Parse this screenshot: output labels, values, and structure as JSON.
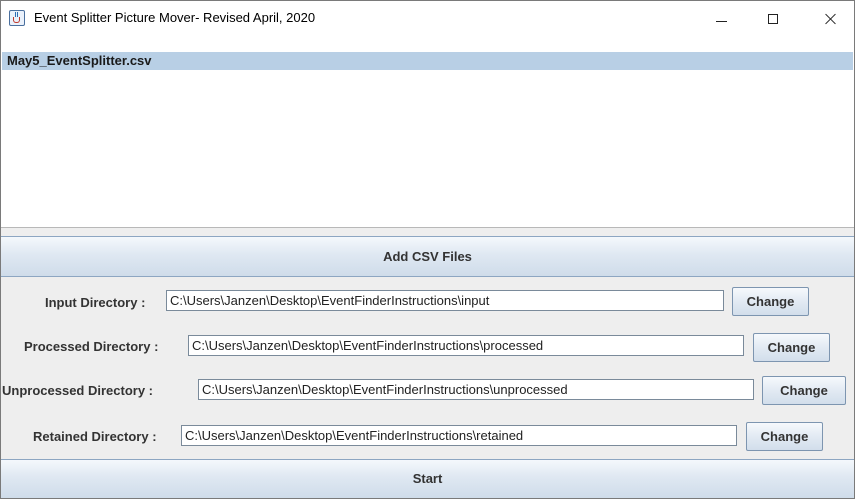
{
  "window": {
    "title": "Event Splitter Picture Mover- Revised April, 2020",
    "icon": "java-cup-icon"
  },
  "file_list": {
    "items": [
      {
        "label": "May5_EventSplitter.csv",
        "selected": true
      }
    ]
  },
  "add_csv_button": {
    "label": "Add CSV Files"
  },
  "directories": {
    "input": {
      "label": "Input Directory :",
      "value": "C:\\Users\\Janzen\\Desktop\\EventFinderInstructions\\input",
      "button": "Change"
    },
    "processed": {
      "label": "Processed Directory :",
      "value": "C:\\Users\\Janzen\\Desktop\\EventFinderInstructions\\processed",
      "button": "Change"
    },
    "unprocessed": {
      "label": "Unprocessed Directory :",
      "value": "C:\\Users\\Janzen\\Desktop\\EventFinderInstructions\\unprocessed",
      "button": "Change"
    },
    "retained": {
      "label": "Retained Directory :",
      "value": "C:\\Users\\Janzen\\Desktop\\EventFinderInstructions\\retained",
      "button": "Change"
    }
  },
  "start_button": {
    "label": "Start"
  },
  "colors": {
    "selection": "#b8cfe5",
    "button_top": "#f4f8fc",
    "button_bottom": "#cfdcea",
    "panel": "#eeeeee"
  }
}
